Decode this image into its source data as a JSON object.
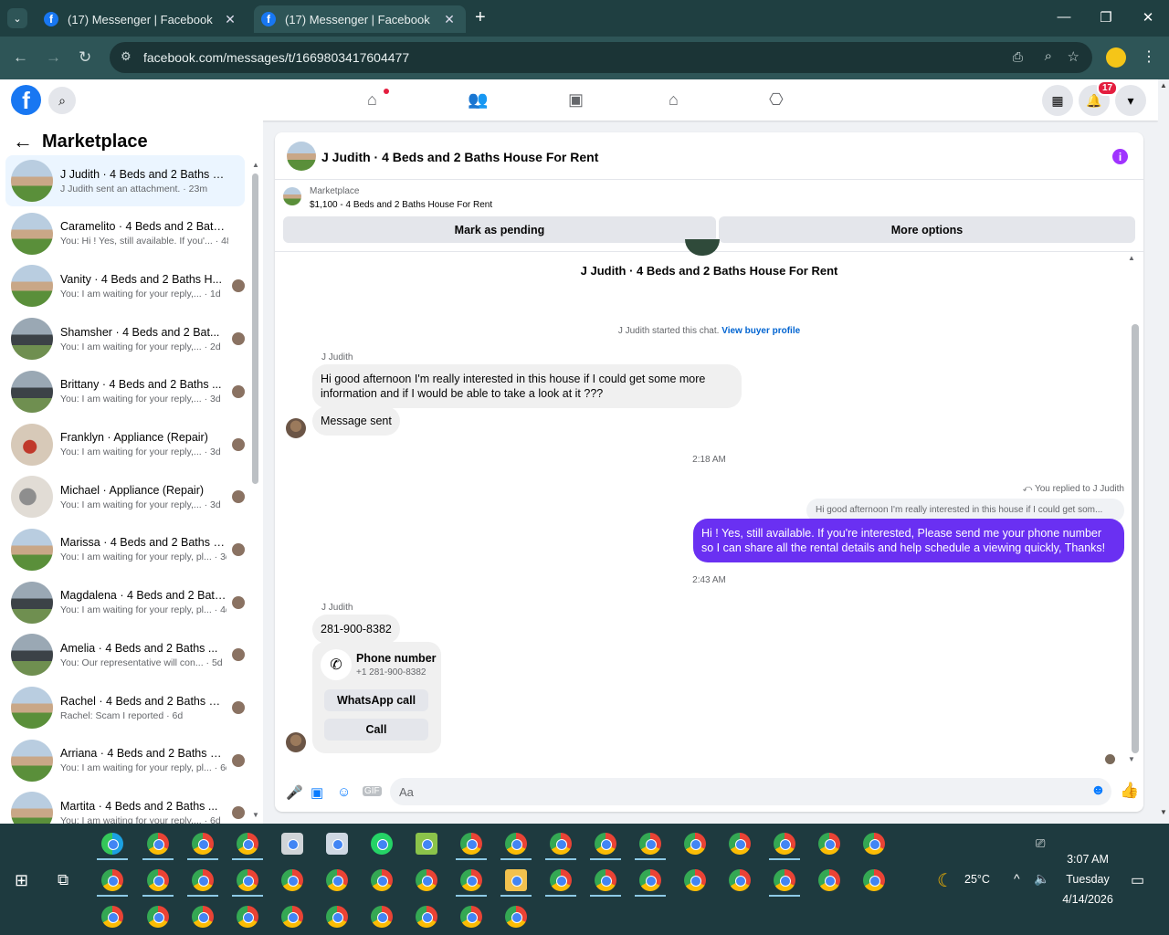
{
  "browser": {
    "tabs": [
      {
        "title": "(17) Messenger | Facebook"
      },
      {
        "title": "(17) Messenger | Facebook"
      }
    ],
    "url": "facebook.com/messages/t/1669803417604477"
  },
  "facebook": {
    "notification_count": "17"
  },
  "sidebar": {
    "title": "Marketplace",
    "conversations": [
      {
        "name": "J Judith · 4 Beds and 2 Baths Ho...",
        "preview": "J Judith sent an attachment. · 23m"
      },
      {
        "name": "Caramelito · 4 Beds and 2 Baths...",
        "preview": "You: Hi ! Yes, still available. If you'... · 48m"
      },
      {
        "name": "Vanity · 4 Beds and 2 Baths H...",
        "preview": "You: I am waiting for your reply,... · 1d"
      },
      {
        "name": "Shamsher · 4 Beds and 2 Bat...",
        "preview": "You: I am waiting for your reply,... · 2d"
      },
      {
        "name": "Brittany · 4 Beds and 2 Baths ...",
        "preview": "You: I am waiting for your reply,... · 3d"
      },
      {
        "name": "Franklyn · Appliance (Repair)",
        "preview": "You: I am waiting for your reply,... · 3d"
      },
      {
        "name": "Michael · Appliance (Repair)",
        "preview": "You: I am waiting for your reply,... · 3d"
      },
      {
        "name": "Marissa · 4 Beds and 2 Baths Ho...",
        "preview": "You: I am waiting for your reply, pl... · 3d"
      },
      {
        "name": "Magdalena · 4 Beds and 2 Baths...",
        "preview": "You: I am waiting for your reply, pl... · 4d"
      },
      {
        "name": "Amelia · 4 Beds and 2 Baths ...",
        "preview": "You: Our representative will con... · 5d"
      },
      {
        "name": "Rachel · 4 Beds and 2 Baths Ho...",
        "preview": "Rachel: Scam I reported · 6d"
      },
      {
        "name": "Arriana · 4 Beds and 2 Baths Ho...",
        "preview": "You: I am waiting for your reply, pl... · 6d"
      },
      {
        "name": "Martita · 4 Beds and 2 Baths ...",
        "preview": "You: I am waiting for your reply,... · 6d"
      }
    ]
  },
  "chat": {
    "header_title": "J Judith · 4 Beds and 2 Baths House For Rent",
    "marketplace_label": "Marketplace",
    "listing": "$1,100 - 4 Beds and 2 Baths House For Rent",
    "mark_pending": "Mark as pending",
    "more_options": "More options",
    "intro_title": "J Judith · 4 Beds and 2 Baths House For Rent",
    "started_text": "J Judith started this chat.",
    "view_profile": "View buyer profile",
    "sender1": "J Judith",
    "msg1": "Hi good afternoon I'm really interested in this house if I could get some more information and if I would be able to take a look at it ???",
    "msg2": "Message sent",
    "time1": "2:18 AM",
    "replied_label": "You replied to J Judith",
    "quoted": "Hi good afternoon I'm really interested in this house if I could get som...",
    "msg3": "Hi ! Yes, still available. If you're interested, Please send me your phone number so I can share all the rental details and help schedule a viewing quickly, Thanks!",
    "time2": "2:43 AM",
    "sender2": "J Judith",
    "msg4": "281-900-8382",
    "phone_title": "Phone number",
    "phone_value": "+1 281-900-8382",
    "whatsapp": "WhatsApp call",
    "call": "Call",
    "input_placeholder": "Aa"
  },
  "taskbar": {
    "weather": "25°C",
    "time": "3:07 AM",
    "day": "Tuesday",
    "date": "4/14/2026"
  },
  "colors": {
    "accent": "#0a7cff",
    "outgoing": "#6a30f2",
    "browser_bg": "#1f3f41"
  }
}
